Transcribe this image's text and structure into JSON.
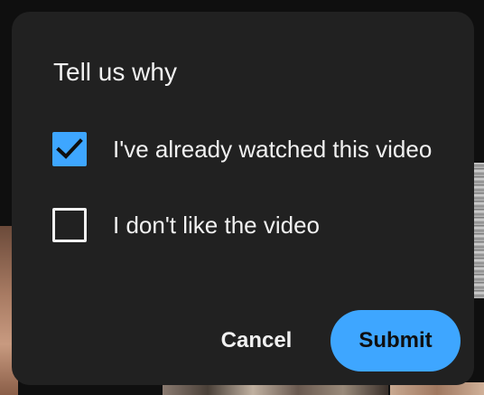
{
  "dialog": {
    "title": "Tell us why",
    "options": [
      {
        "label": "I've already watched this video",
        "checked": true
      },
      {
        "label": "I don't like the video",
        "checked": false
      }
    ],
    "cancel_label": "Cancel",
    "submit_label": "Submit"
  },
  "colors": {
    "accent": "#3ea6ff",
    "dialog_bg": "#212121",
    "text": "#f1f1f1"
  },
  "icons": {
    "checked": "checkmark-icon"
  }
}
